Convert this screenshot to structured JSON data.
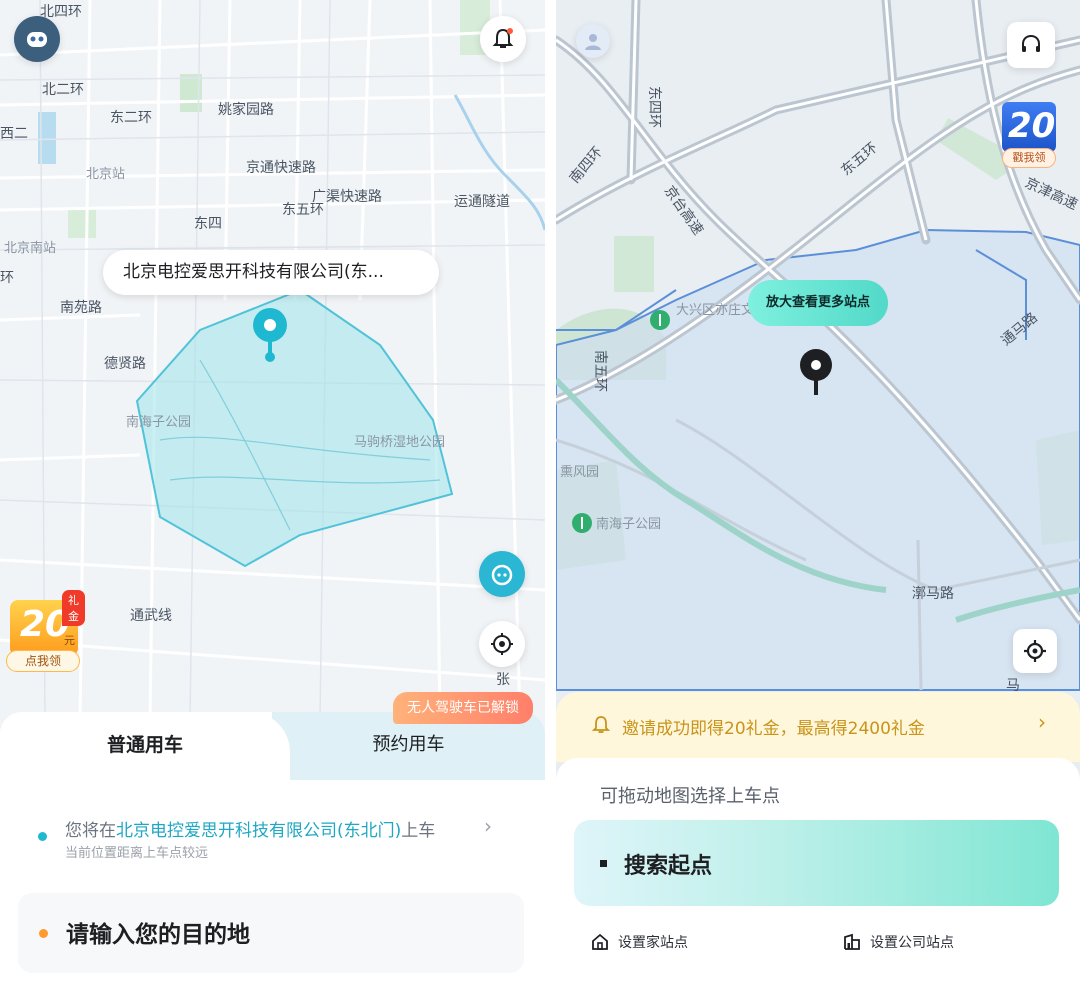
{
  "left": {
    "map_labels": {
      "north_4th_ring": "北四环",
      "north_2nd_ring": "北二环",
      "west_2nd_ring": "西二",
      "east_2nd_ring": "东二环",
      "beijing_station": "北京站",
      "yaojiayuan_rd": "姚家园路",
      "jingtong_expwy": "京通快速路",
      "guangqu_expwy": "广渠快速路",
      "yuntong_tunnel": "运通隧道",
      "east_4th_ring": "东四",
      "east_5th_ring": "东五环",
      "beijing_south": "北京南站",
      "ring_fragment": "环",
      "nanyuan_rd": "南苑路",
      "dexian_rd": "德贤路",
      "nanhaizi_park": "南海子公园",
      "magouqiao_park": "马驹桥湿地公园",
      "tongwu_line": "通武线",
      "edge_fragment": "张"
    },
    "callout": "北京电控爱思开科技有限公司(东...",
    "promo": {
      "badge": "礼金",
      "amount": "20",
      "unit": "元",
      "button": "点我领"
    },
    "tabs": {
      "normal": "普通用车",
      "booking": "预约用车",
      "locked_badge": "无人驾驶车已解锁"
    },
    "pickup": {
      "prefix": "您将在",
      "place": "北京电控爱思开科技有限公司(东北门)",
      "suffix": "上车",
      "hint": "当前位置距离上车点较远"
    },
    "destination_placeholder": "请输入您的目的地"
  },
  "right": {
    "map_labels": {
      "east_4th_ring": "东四环",
      "south_4th_ring": "南四环",
      "jingtai_expwy": "京台高速",
      "east_5th_ring": "东五环",
      "jingjin_expwy": "京津高速",
      "daxing_park": "大兴区亦庄文化园",
      "tongma_rd": "通马路",
      "south_5th_ring": "南五环",
      "xunfeng_park": "熏风园",
      "nanhaizi_park": "南海子公园",
      "yuma_rd": "漷马路",
      "edge_fragment": "马"
    },
    "zoom_tip": "放大查看更多站点",
    "promo": {
      "amount": "20",
      "button": "戳我领"
    },
    "invite": "邀请成功即得20礼金，最高得2400礼金",
    "drag_hint": "可拖动地图选择上车点",
    "search_start": "搜索起点",
    "home_station": "设置家站点",
    "company_station": "设置公司站点"
  },
  "colors": {
    "accent_teal": "#1fb8d1",
    "area_fill": "#9fe3ea",
    "warning_orange": "#ff9a2e"
  },
  "icons": [
    "robot-avatar-icon",
    "bell-icon",
    "customer-service-icon",
    "locate-icon",
    "user-avatar-icon",
    "headset-icon",
    "home-icon",
    "company-icon",
    "chevron-right-icon",
    "map-pin-icon",
    "tree-icon"
  ]
}
